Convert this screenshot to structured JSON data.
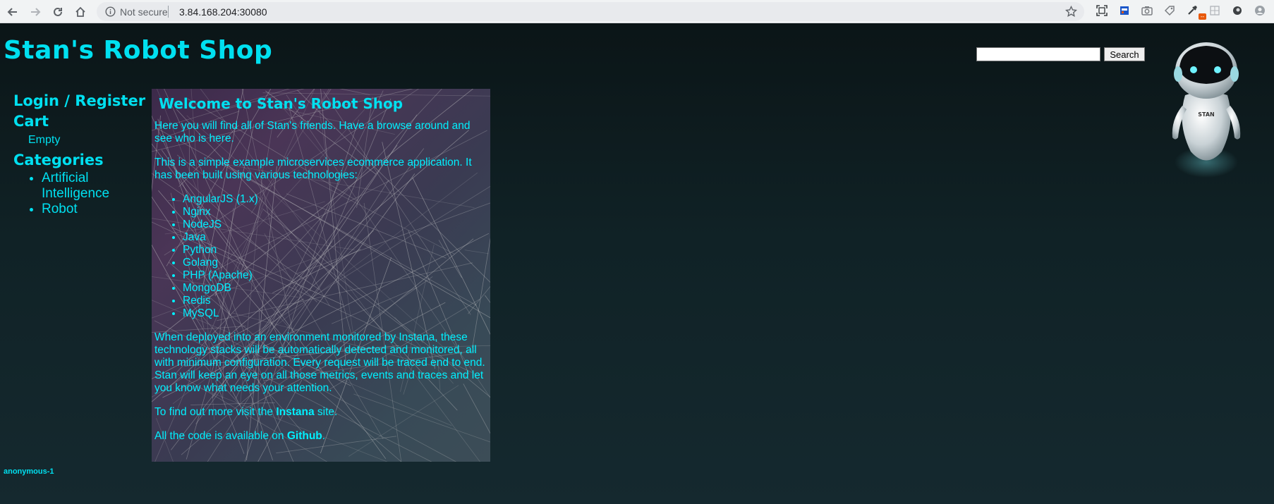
{
  "browser": {
    "security_label": "Not secure",
    "url": "3.84.168.204:30080",
    "extension_badge": "--"
  },
  "header": {
    "site_title": "Stan's Robot Shop",
    "search_value": "",
    "search_button": "Search",
    "mascot_text": "STAN"
  },
  "sidebar": {
    "login_label": "Login / Register",
    "cart_label": "Cart",
    "cart_status": "Empty",
    "categories_label": "Categories",
    "categories": [
      "Artificial Intelligence",
      "Robot"
    ]
  },
  "main": {
    "title": "Welcome to Stan's Robot Shop",
    "intro": "Here you will find all of Stan's friends. Have a browse around and see who is here.",
    "description": "This is a simple example microservices ecommerce application. It has been built using various technologies:",
    "technologies": [
      "AngularJS (1.x)",
      "Nginx",
      "NodeJS",
      "Java",
      "Python",
      "Golang",
      "PHP (Apache)",
      "MongoDB",
      "Redis",
      "MySQL"
    ],
    "monitoring": "When deployed into an environment monitored by Instana, these technology stacks will be automatically detected and monitored, all with minimum configuration. Every request will be traced end to end. Stan will keep an eye on all those metrics, events and traces and let you know what needs your attention.",
    "find_out_prefix": "To find out more visit the ",
    "instana_link": "Instana",
    "find_out_suffix": " site.",
    "code_prefix": "All the code is available on ",
    "github_link": "Github",
    "code_suffix": "."
  },
  "footer": {
    "user": "anonymous-1"
  },
  "colors": {
    "accent": "#00e0f0",
    "page_background": "#142a2f"
  }
}
